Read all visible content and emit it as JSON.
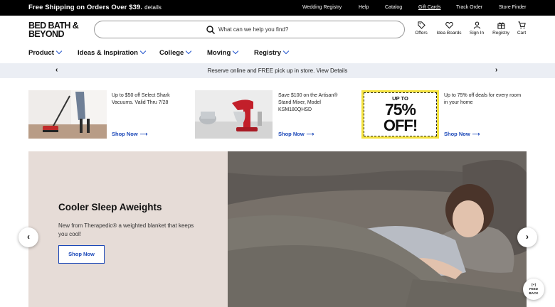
{
  "topbar": {
    "promo": "Free Shipping on Orders Over $39.",
    "details": "details",
    "links": [
      "Wedding Registry",
      "Help",
      "Catalog",
      "Gift Cards",
      "Track Order",
      "Store Finder"
    ]
  },
  "header": {
    "logo_line1": "BED BATH &",
    "logo_line2": "BEYOND",
    "search_placeholder": "What can we help you find?",
    "icons": [
      {
        "label": "Offers",
        "icon": "tag-icon"
      },
      {
        "label": "Idea Boards",
        "icon": "heart-icon"
      },
      {
        "label": "Sign In",
        "icon": "user-icon"
      },
      {
        "label": "Registry",
        "icon": "gift-icon"
      },
      {
        "label": "Cart",
        "icon": "cart-icon"
      }
    ]
  },
  "nav": {
    "items": [
      "Product",
      "Ideas & Inspiration",
      "College",
      "Moving",
      "Registry"
    ]
  },
  "band": {
    "text": "Reserve online and FREE pick up in store. View Details"
  },
  "tiles": [
    {
      "text": "Up to $50 off Select Shark Vacuums. Valid Thru 7/28",
      "cta": "Shop Now"
    },
    {
      "text": "Save $100 on the Artisan® Stand Mixer, Model KSM180QHSD",
      "cta": "Shop Now"
    },
    {
      "text": "Up to 75% off deals for every room in your home",
      "cta": "Shop Now",
      "badge_top": "UP TO",
      "badge_main": "75%",
      "badge_bottom": "OFF!"
    }
  ],
  "hero": {
    "title": "Cooler Sleep Aweights",
    "subtitle": "New from Therapedic® a weighted blanket that keeps you cool!",
    "cta": "Shop Now"
  },
  "feedback": {
    "line1": "[+]",
    "line2": "FEED",
    "line3": "BACK"
  },
  "colors": {
    "accent": "#1a47b8",
    "topbar": "#000000",
    "band": "#ebeef4",
    "hero_left": "#e6dcd7",
    "badge_yellow": "#f5e33d"
  }
}
